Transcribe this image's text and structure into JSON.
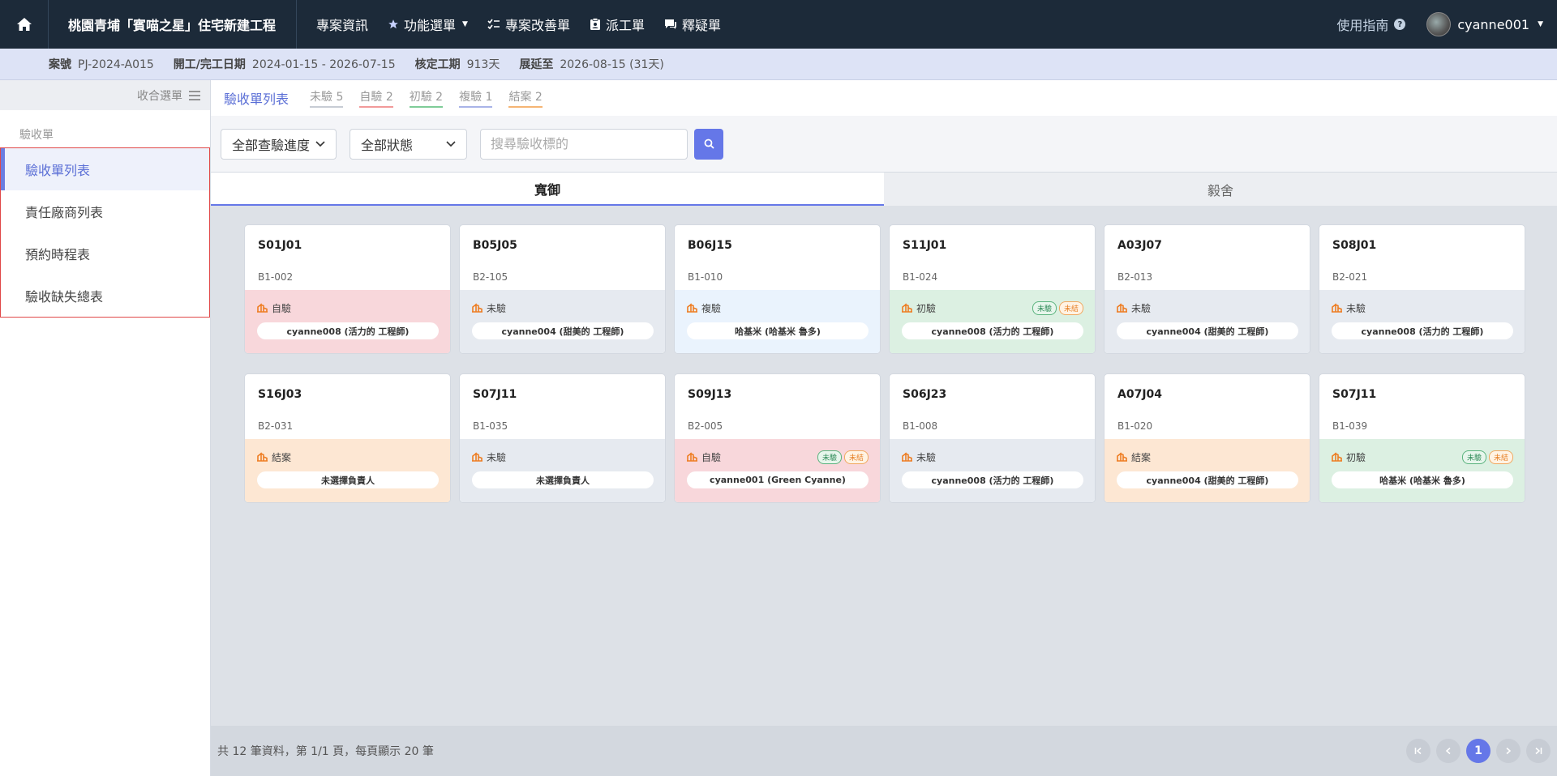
{
  "project": {
    "title": "桃園青埔「賓喵之星」住宅新建工程"
  },
  "nav": {
    "items": [
      {
        "label": "專案資訊",
        "icon": "none"
      },
      {
        "label": "功能選單",
        "icon": "star-icon"
      },
      {
        "label": "專案改善單",
        "icon": "checklist-icon"
      },
      {
        "label": "派工單",
        "icon": "clipboard-icon"
      },
      {
        "label": "釋疑單",
        "icon": "chat-icon"
      }
    ],
    "guide": "使用指南",
    "user": "cyanne001"
  },
  "info": {
    "case_label": "案號",
    "case_value": "PJ-2024-A015",
    "dates_label": "開工/完工日期",
    "dates_value": "2024-01-15 - 2026-07-15",
    "period_label": "核定工期",
    "period_value": "913天",
    "ext_label": "展延至",
    "ext_value": "2026-08-15 (31天)"
  },
  "sidebar": {
    "collapse_label": "收合選單",
    "section": "驗收單",
    "items": [
      {
        "label": "驗收單列表",
        "active": true
      },
      {
        "label": "責任廠商列表",
        "active": false
      },
      {
        "label": "預約時程表",
        "active": false
      },
      {
        "label": "驗收缺失總表",
        "active": false
      }
    ]
  },
  "tabs": {
    "main": "驗收單列表",
    "sub": [
      {
        "label": "未驗 5",
        "color": "#c7ccd4"
      },
      {
        "label": "自驗 2",
        "color": "#f29a9a"
      },
      {
        "label": "初驗 2",
        "color": "#7fcc98"
      },
      {
        "label": "複驗 1",
        "color": "#a9b4e8"
      },
      {
        "label": "結案 2",
        "color": "#f5b574"
      }
    ]
  },
  "filters": {
    "progress": "全部查驗進度",
    "status": "全部狀態",
    "search_placeholder": "搜尋驗收標的"
  },
  "buildings": {
    "tab1": "寬御",
    "tab2": "毅舍"
  },
  "status_colors": {
    "自驗": "#f8d7db",
    "未驗": "#e6eaf0",
    "複驗": "#eaf3fd",
    "初驗": "#dcf0e2",
    "結案": "#fde7d3"
  },
  "cards": [
    {
      "id": "S01J01",
      "unit": "B1-002",
      "status": "自驗",
      "person": "cyanne008 (活力的 工程師)",
      "badges": []
    },
    {
      "id": "B05J05",
      "unit": "B2-105",
      "status": "未驗",
      "person": "cyanne004 (甜美的 工程師)",
      "badges": []
    },
    {
      "id": "B06J15",
      "unit": "B1-010",
      "status": "複驗",
      "person": "哈基米 (哈基米 魯多)",
      "badges": []
    },
    {
      "id": "S11J01",
      "unit": "B1-024",
      "status": "初驗",
      "person": "cyanne008 (活力的 工程師)",
      "badges": [
        [
          "未驗",
          "g"
        ],
        [
          "未結",
          "o"
        ]
      ]
    },
    {
      "id": "A03J07",
      "unit": "B2-013",
      "status": "未驗",
      "person": "cyanne004 (甜美的 工程師)",
      "badges": []
    },
    {
      "id": "S08J01",
      "unit": "B2-021",
      "status": "未驗",
      "person": "cyanne008 (活力的 工程師)",
      "badges": []
    },
    {
      "id": "S16J03",
      "unit": "B2-031",
      "status": "結案",
      "person": "未選擇負責人",
      "badges": []
    },
    {
      "id": "S07J11",
      "unit": "B1-035",
      "status": "未驗",
      "person": "未選擇負責人",
      "badges": []
    },
    {
      "id": "S09J13",
      "unit": "B2-005",
      "status": "自驗",
      "person": "cyanne001 (Green Cyanne)",
      "badges": [
        [
          "未驗",
          "g"
        ],
        [
          "未結",
          "o"
        ]
      ]
    },
    {
      "id": "S06J23",
      "unit": "B1-008",
      "status": "未驗",
      "person": "cyanne008 (活力的 工程師)",
      "badges": []
    },
    {
      "id": "A07J04",
      "unit": "B1-020",
      "status": "結案",
      "person": "cyanne004 (甜美的 工程師)",
      "badges": []
    },
    {
      "id": "S07J11",
      "unit": "B1-039",
      "status": "初驗",
      "person": "哈基米 (哈基米 魯多)",
      "badges": [
        [
          "未驗",
          "g"
        ],
        [
          "未結",
          "o"
        ]
      ]
    }
  ],
  "footer": {
    "summary": "共 12 筆資料，第 1/1 頁，每頁顯示 20 筆",
    "current_page": "1"
  }
}
